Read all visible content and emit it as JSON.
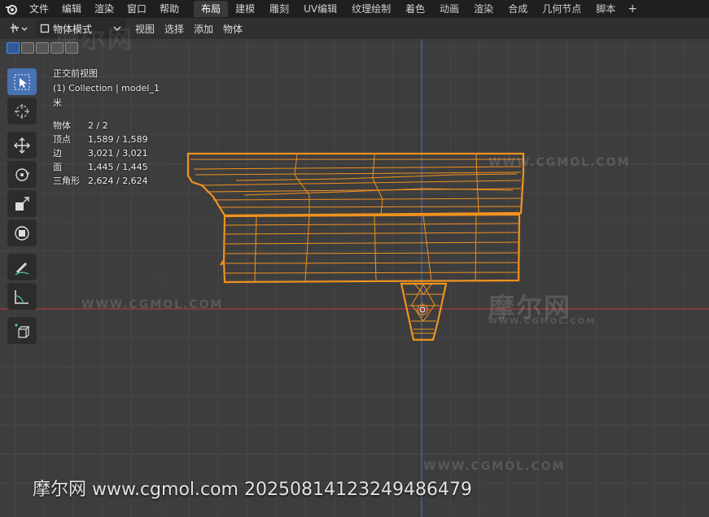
{
  "menu": {
    "items": [
      "文件",
      "编辑",
      "渲染",
      "窗口",
      "帮助"
    ]
  },
  "workspaces": {
    "tabs": [
      "布局",
      "建模",
      "雕刻",
      "UV编辑",
      "纹理绘制",
      "着色",
      "动画",
      "渲染",
      "合成",
      "几何节点",
      "脚本"
    ],
    "active": "布局",
    "add_label": "+"
  },
  "header": {
    "mode": "物体模式",
    "menus": [
      "视图",
      "选择",
      "添加",
      "物体"
    ]
  },
  "viewport": {
    "view_name": "正交前视图",
    "collection": "(1) Collection | model_1",
    "units": "米",
    "stats": [
      {
        "label": "物体",
        "value": "2 / 2"
      },
      {
        "label": "顶点",
        "value": "1,589 / 1,589"
      },
      {
        "label": "边",
        "value": "3,021 / 3,021"
      },
      {
        "label": "面",
        "value": "1,445 / 1,445"
      },
      {
        "label": "三角形",
        "value": "2,624 / 2,624"
      }
    ]
  },
  "tools": [
    "select-box-icon",
    "cursor-icon",
    "move-icon",
    "rotate-icon",
    "scale-icon",
    "transform-icon",
    "annotate-icon",
    "measure-icon",
    "add-cube-icon"
  ],
  "watermarks": {
    "logo_text": "摩尔网",
    "site_text": "WWW.CGMOL.COM",
    "footer": "摩尔网 www.cgmol.com 20250814123249486479"
  },
  "colors": {
    "wire": "#f0921f",
    "x_axis": "#a83a3a",
    "z_axis": "#3f6fb6",
    "active_tool": "#4772b3"
  }
}
